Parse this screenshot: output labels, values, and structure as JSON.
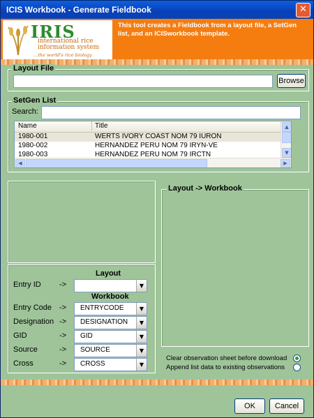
{
  "window": {
    "title": "ICIS Workbook - Generate Fieldbook",
    "close_glyph": "✕"
  },
  "banner": {
    "logo_text": "IRIS",
    "logo_subtitle": "international rice information system",
    "logo_tagline": "...the world's rice biology repository",
    "description": "This tool creates a Fieldbook from a layout file, a SetGen list, and an ICISworkbook template."
  },
  "layout_file": {
    "label": "Layout File",
    "value": "",
    "browse_label": "Browse"
  },
  "setgen": {
    "label": "SetGen List",
    "search_label": "Search:",
    "search_value": "",
    "columns": [
      "Name",
      "Title"
    ],
    "rows": [
      {
        "name": "1980-001",
        "title": "WERTS IVORY COAST NOM 79 IURON"
      },
      {
        "name": "1980-002",
        "title": "HERNANDEZ PERU NOM 79 IRYN-VE"
      },
      {
        "name": "1980-003",
        "title": "HERNANDEZ PERU NOM 79 IRCTN"
      }
    ]
  },
  "mapping": {
    "layout_header": "Layout",
    "workbook_header": "Workbook",
    "arrow": "->",
    "entry_id": {
      "label": "Entry ID",
      "value": ""
    },
    "fields": [
      {
        "label": "Entry Code",
        "value": "ENTRYCODE"
      },
      {
        "label": "Designation",
        "value": "DESIGNATION"
      },
      {
        "label": "GID",
        "value": "GID"
      },
      {
        "label": "Source",
        "value": "SOURCE"
      },
      {
        "label": "Cross",
        "value": "CROSS"
      }
    ]
  },
  "layout_workbook": {
    "label": "Layout -> Workbook"
  },
  "options": {
    "clear_label": "Clear observation sheet before download",
    "append_label": "Append list data to existing observations",
    "selected": "clear"
  },
  "buttons": {
    "ok": "OK",
    "cancel": "Cancel"
  },
  "colors": {
    "banner": "#f57d10",
    "panel": "#9fc49a",
    "titlebar": "#0a3fb8"
  }
}
